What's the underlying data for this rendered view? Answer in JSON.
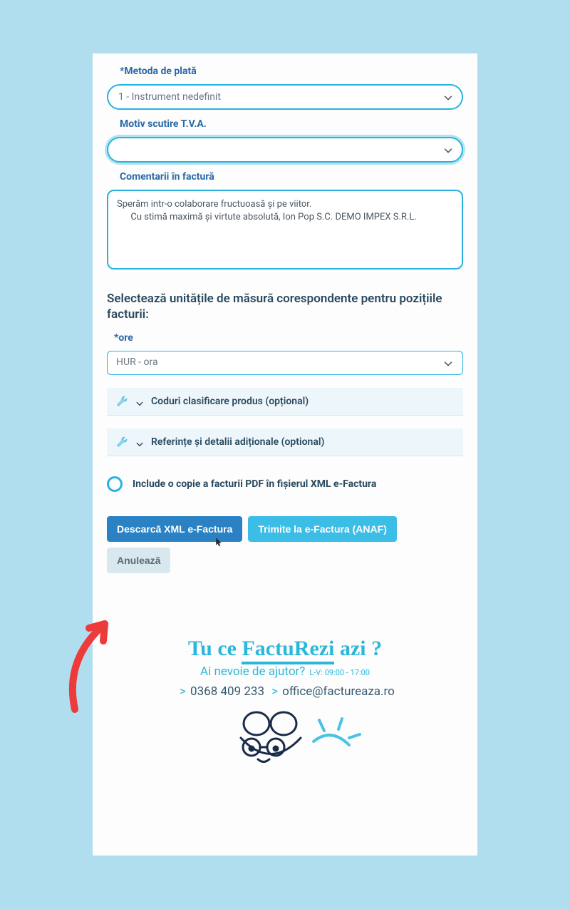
{
  "labels": {
    "payment_method": "Metoda de plată",
    "vat_exempt": "Motiv scutire T.V.A.",
    "invoice_comments": "Comentarii în factură",
    "units_title": "Selectează unitățile de măsură corespondente pentru pozițiile facturii:",
    "hours": "ore"
  },
  "fields": {
    "payment_method_value": "1 - Instrument nedefinit",
    "vat_exempt_value": "",
    "comments_value": "Sperăm intr-o colaborare fructuoasă și pe viitor.\n      Cu stimă maximă și virtute absolută, Ion Pop S.C. DEMO IMPEX S.R.L.",
    "hours_value": "HUR - ora"
  },
  "expanders": {
    "codes": "Coduri clasificare produs (opțional)",
    "refs": "Referințe și detalii adiționale (optional)"
  },
  "checkbox": {
    "include_pdf": "Include o copie a facturii PDF în fișierul XML e-Factura"
  },
  "buttons": {
    "download_xml": "Descarcă XML e-Factura",
    "send_anaf": "Trimite la e-Factura (ANAF)",
    "cancel": "Anulează"
  },
  "footer": {
    "slogan_pre": "Tu ce ",
    "slogan_mid": "FactuRezi",
    "slogan_post": " azi ?",
    "help": "Ai nevoie de ajutor?",
    "hours": "L-V: 09:00 - 17:00",
    "phone": "0368 409 233",
    "email": "office@factureaza.ro"
  }
}
